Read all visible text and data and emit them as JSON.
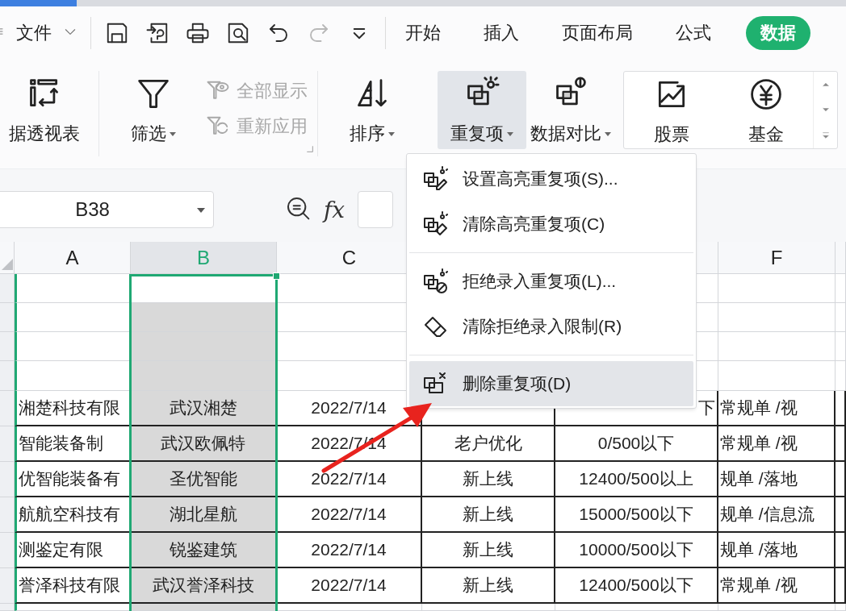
{
  "menu_bar": {
    "file_label": "文件",
    "quick_access": [
      {
        "kind": "save",
        "disabled": false
      },
      {
        "kind": "export",
        "disabled": false
      },
      {
        "kind": "print",
        "disabled": false
      },
      {
        "kind": "preview",
        "disabled": false
      },
      {
        "kind": "undo",
        "disabled": false
      },
      {
        "kind": "redo",
        "disabled": true
      },
      {
        "kind": "customize",
        "disabled": false
      }
    ],
    "tabs": [
      {
        "label": "开始",
        "selected": false
      },
      {
        "label": "插入",
        "selected": false
      },
      {
        "label": "页面布局",
        "selected": false
      },
      {
        "label": "公式",
        "selected": false
      },
      {
        "label": "数据",
        "selected": true
      }
    ]
  },
  "ribbon": {
    "groups": [
      {
        "large": [
          {
            "kind": "pivot",
            "label": "据透视表",
            "dropdown": false,
            "pressed": false
          }
        ]
      },
      {
        "large": [
          {
            "kind": "filter",
            "label": "筛选",
            "dropdown": true,
            "pressed": false
          }
        ],
        "small": [
          {
            "kind": "show_all",
            "label": "全部显示",
            "disabled": true
          },
          {
            "kind": "reapply",
            "label": "重新应用",
            "disabled": true
          }
        ]
      },
      {
        "large": [
          {
            "kind": "sort",
            "label": "排序",
            "dropdown": true,
            "pressed": false
          }
        ]
      },
      {
        "large": [
          {
            "kind": "duplicates",
            "label": "重复项",
            "dropdown": true,
            "pressed": true
          },
          {
            "kind": "compare",
            "label": "数据对比",
            "dropdown": true,
            "pressed": false
          }
        ]
      }
    ],
    "gallery": [
      {
        "kind": "stock",
        "label": "股票"
      },
      {
        "kind": "fund",
        "label": "基金"
      }
    ]
  },
  "formula_bar": {
    "name_box": "B38",
    "function_label": "fx"
  },
  "sheet": {
    "columns": [
      {
        "label": "A",
        "selected": false
      },
      {
        "label": "B",
        "selected": true
      },
      {
        "label": "C",
        "selected": false
      },
      null,
      null,
      {
        "label": "F",
        "selected": false
      },
      {
        "selected": false
      }
    ],
    "rows": [
      {
        "a": "湘楚科技有限",
        "b": "武汉湘楚",
        "c": "2022/7/14",
        "covered": true,
        "e": "下",
        "f": "常规单 /视"
      },
      {
        "a": "智能装备制",
        "b": "武汉欧佩特",
        "c": "2022/7/14",
        "d": "老户优化",
        "e": "0/500以下",
        "f": "常规单 /视"
      },
      {
        "a": "优智能装备有",
        "b": "圣优智能",
        "c": "2022/7/14",
        "d": "新上线",
        "e": "12400/500以上",
        "f": "规单 /落地"
      },
      {
        "a": "航航空科技有",
        "b": "湖北星航",
        "c": "2022/7/14",
        "d": "新上线",
        "e": "15000/500以下",
        "f": "规单 /信息流"
      },
      {
        "a": "测鉴定有限",
        "b": "锐鉴建筑",
        "c": "2022/7/14",
        "d": "新上线",
        "e": "10000/500以下",
        "f": "规单 /落地"
      },
      {
        "a": "誉泽科技有限",
        "b": "武汉誉泽科技",
        "c": "2022/7/14",
        "d": "新上线",
        "e": "12400/500以下",
        "f": "常规单 /视"
      }
    ]
  },
  "dropdown_menu": {
    "groups": [
      [
        {
          "kind": "highlight",
          "label": "设置高亮重复项(S)...",
          "selected": false
        },
        {
          "kind": "clear_highlight",
          "label": "清除高亮重复项(C)",
          "selected": false
        }
      ],
      [
        {
          "kind": "reject",
          "label": "拒绝录入重复项(L)...",
          "selected": false
        },
        {
          "kind": "clear_reject",
          "label": "清除拒绝录入限制(R)",
          "selected": false
        }
      ],
      [
        {
          "kind": "delete",
          "label": "删除重复项(D)",
          "selected": true
        }
      ]
    ]
  }
}
